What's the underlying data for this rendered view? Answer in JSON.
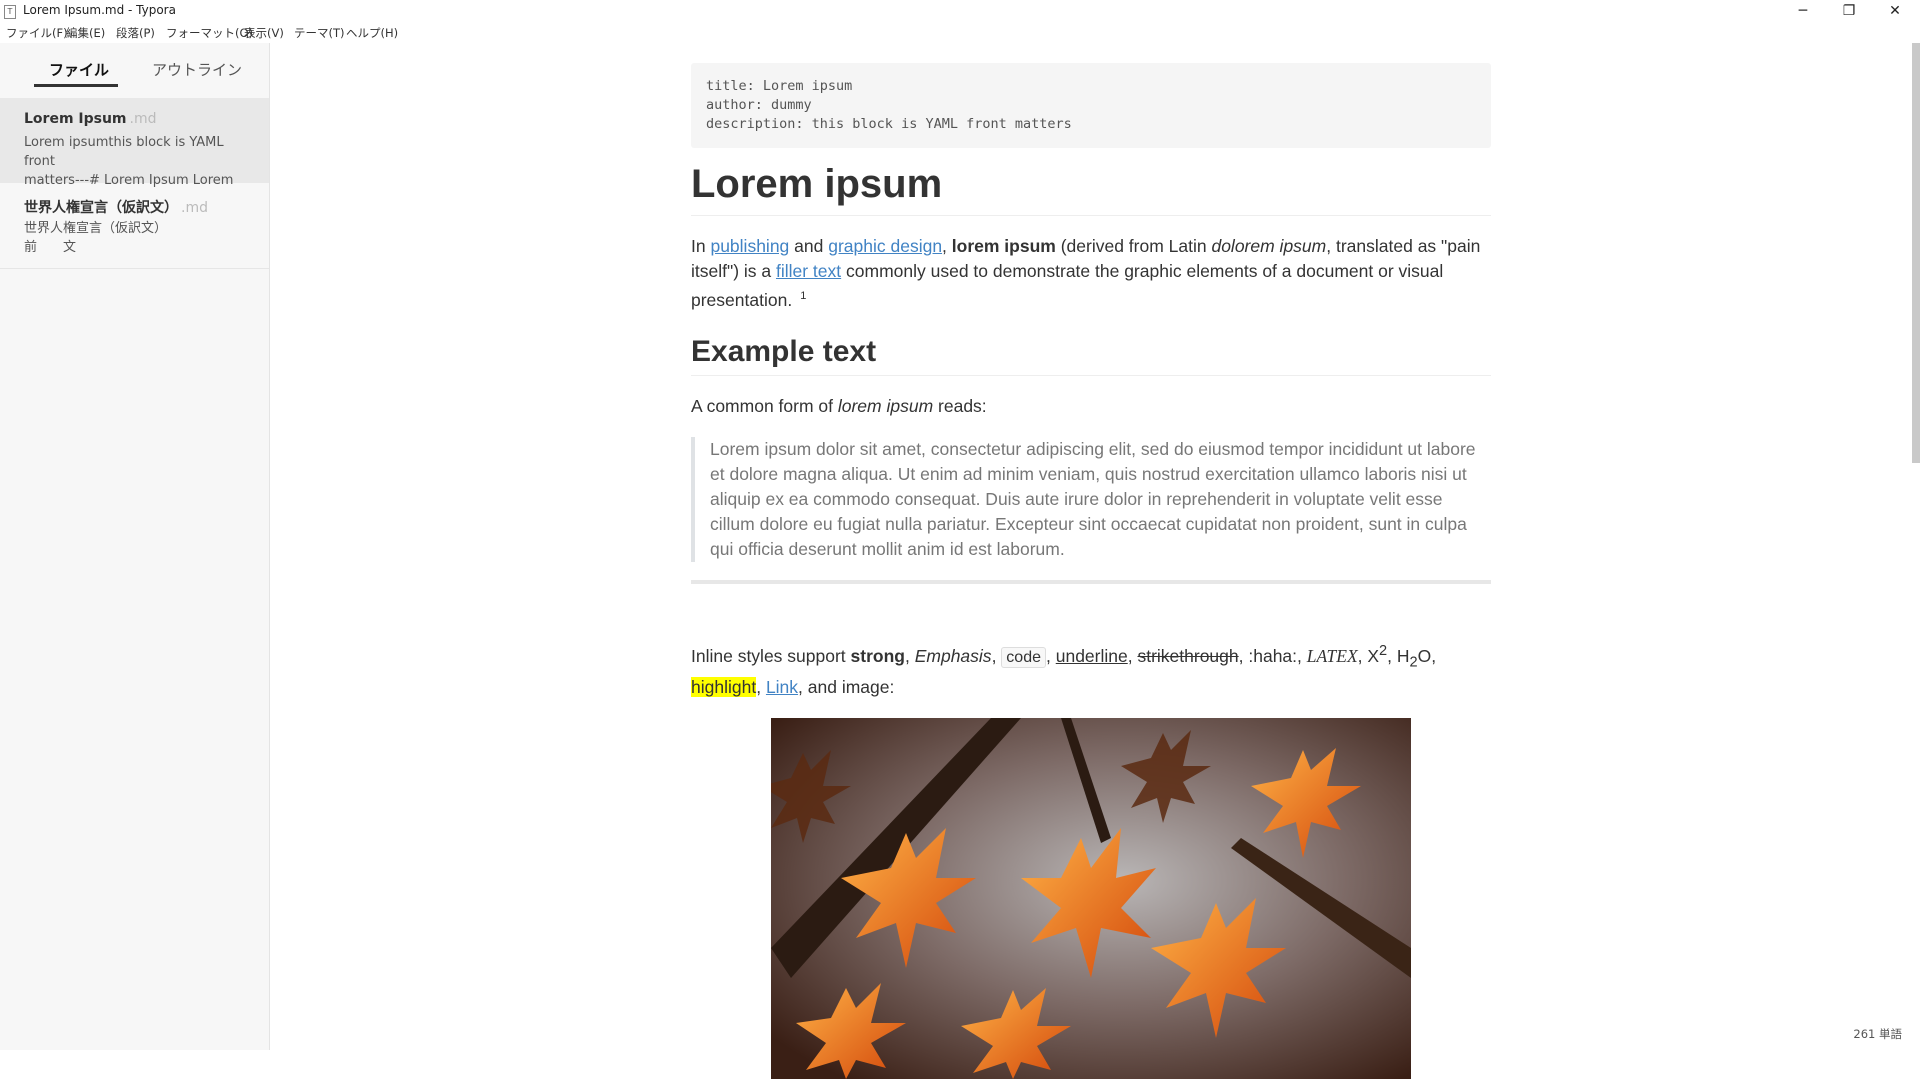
{
  "window": {
    "title": "Lorem Ipsum.md - Typora",
    "minimize": "─",
    "maximize": "❐",
    "close": "✕"
  },
  "menu": [
    "ファイル(F)",
    "編集(E)",
    "段落(P)",
    "フォーマット(O)",
    "表示(V)",
    "テーマ(T)",
    "ヘルプ(H)"
  ],
  "sidebar": {
    "tabs": [
      {
        "label": "ファイル",
        "active": true
      },
      {
        "label": "アウトライン",
        "active": false
      }
    ],
    "files": [
      {
        "title": "Lorem Ipsum",
        "ext": ".md",
        "excerpt_lines": [
          "Lorem ipsumthis block is YAML front",
          "matters---# Lorem Ipsum Lorem"
        ]
      },
      {
        "title": "世界人権宣言（仮訳文）",
        "ext": ".md",
        "excerpt_lines": [
          "世界人権宣言（仮訳文）",
          "前　　文"
        ]
      }
    ],
    "bottom_icons": {
      "toggle": "‹",
      "source": "</>"
    }
  },
  "editor": {
    "yaml": "title: Lorem ipsum\nauthor: dummy\ndescription: this block is YAML front matters",
    "h1": "Lorem ipsum",
    "intro": {
      "t1": "In ",
      "link1": "publishing",
      "t2": " and ",
      "link2": "graphic design",
      "t3": ", ",
      "strong": "lorem ipsum",
      "t4": " (derived from Latin ",
      "em": "dolorem ipsum",
      "t5": ", translated as \"pain itself\") is a ",
      "link3": "filler text",
      "t6": " commonly used to demonstrate the graphic elements of a document or visual presentation.",
      "footnote": "1"
    },
    "h2": "Example text",
    "common": {
      "t1": "A common form of ",
      "em": "lorem ipsum",
      "t2": " reads:"
    },
    "quote": "Lorem ipsum dolor sit amet, consectetur adipiscing elit, sed do eiusmod tempor incididunt ut labore et dolore magna aliqua. Ut enim ad minim veniam, quis nostrud exercitation ullamco laboris nisi ut aliquip ex ea commodo consequat. Duis aute irure dolor in reprehenderit in voluptate velit esse cillum dolore eu fugiat nulla pariatur. Excepteur sint occaecat cupidatat non proident, sunt in culpa qui officia deserunt mollit anim id est laborum.",
    "inline": {
      "t1": "Inline styles support ",
      "strong": "strong",
      "c1": ", ",
      "em": "Emphasis",
      "c2": ", ",
      "code": "code",
      "c3": ", ",
      "underline": "underline",
      "c4": ", ",
      "strike": "strikethrough",
      "c5": ", :haha:, ",
      "latex": "LATEX",
      "c6": ", X",
      "sup": "2",
      "c7": ", H",
      "sub": "2",
      "c8": "O, ",
      "highlight": "highlight",
      "c9": ", ",
      "link": "Link",
      "c10": ", and image:"
    },
    "image_alt": "autumn maple leaves"
  },
  "status": {
    "word_count": "261 単語"
  }
}
